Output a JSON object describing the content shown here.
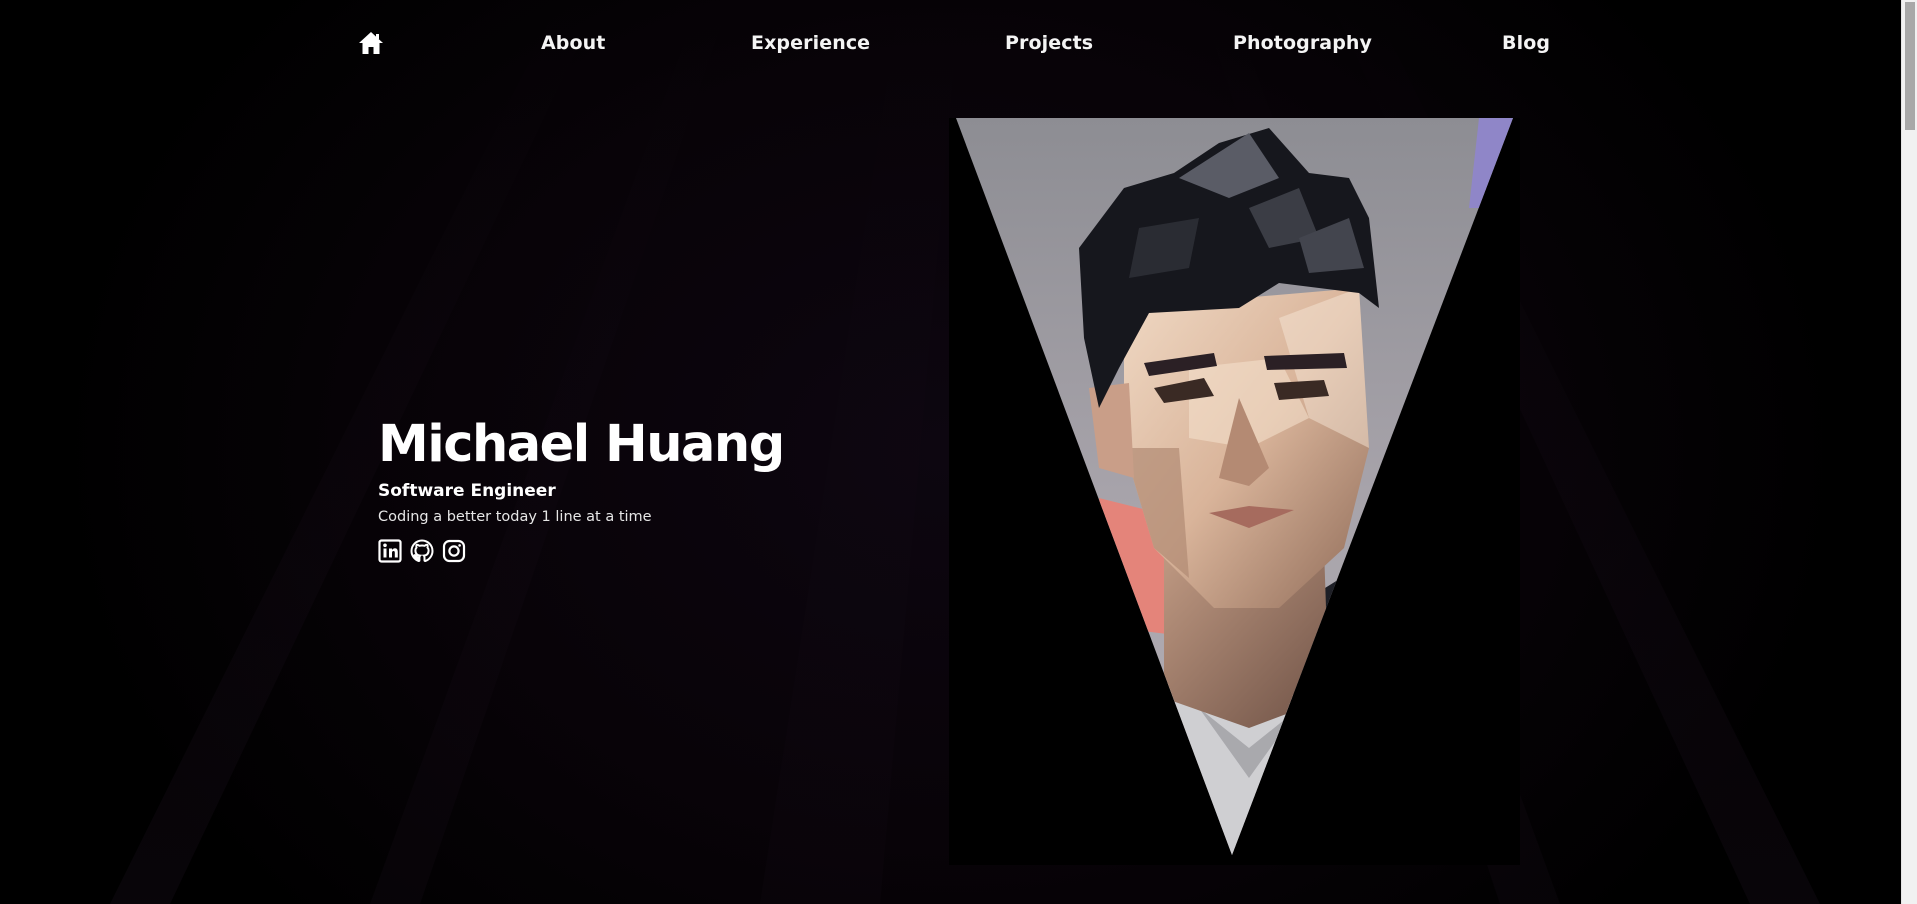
{
  "nav": {
    "home_icon": "home-icon",
    "items": [
      {
        "label": "About"
      },
      {
        "label": "Experience"
      },
      {
        "label": "Projects"
      },
      {
        "label": "Photography"
      },
      {
        "label": "Blog"
      }
    ]
  },
  "hero": {
    "name": "Michael Huang",
    "role": "Software Engineer",
    "tagline": "Coding a better today 1 line at a time",
    "socials": [
      {
        "icon": "linkedin-icon"
      },
      {
        "icon": "github-icon"
      },
      {
        "icon": "instagram-icon"
      }
    ]
  },
  "portrait": {
    "icon": "low-poly-portrait",
    "shape": "inverted-triangle"
  },
  "colors": {
    "background": "#000000",
    "text": "#ffffff",
    "accent_purple": "#8f86c8",
    "accent_coral": "#e4847a"
  }
}
